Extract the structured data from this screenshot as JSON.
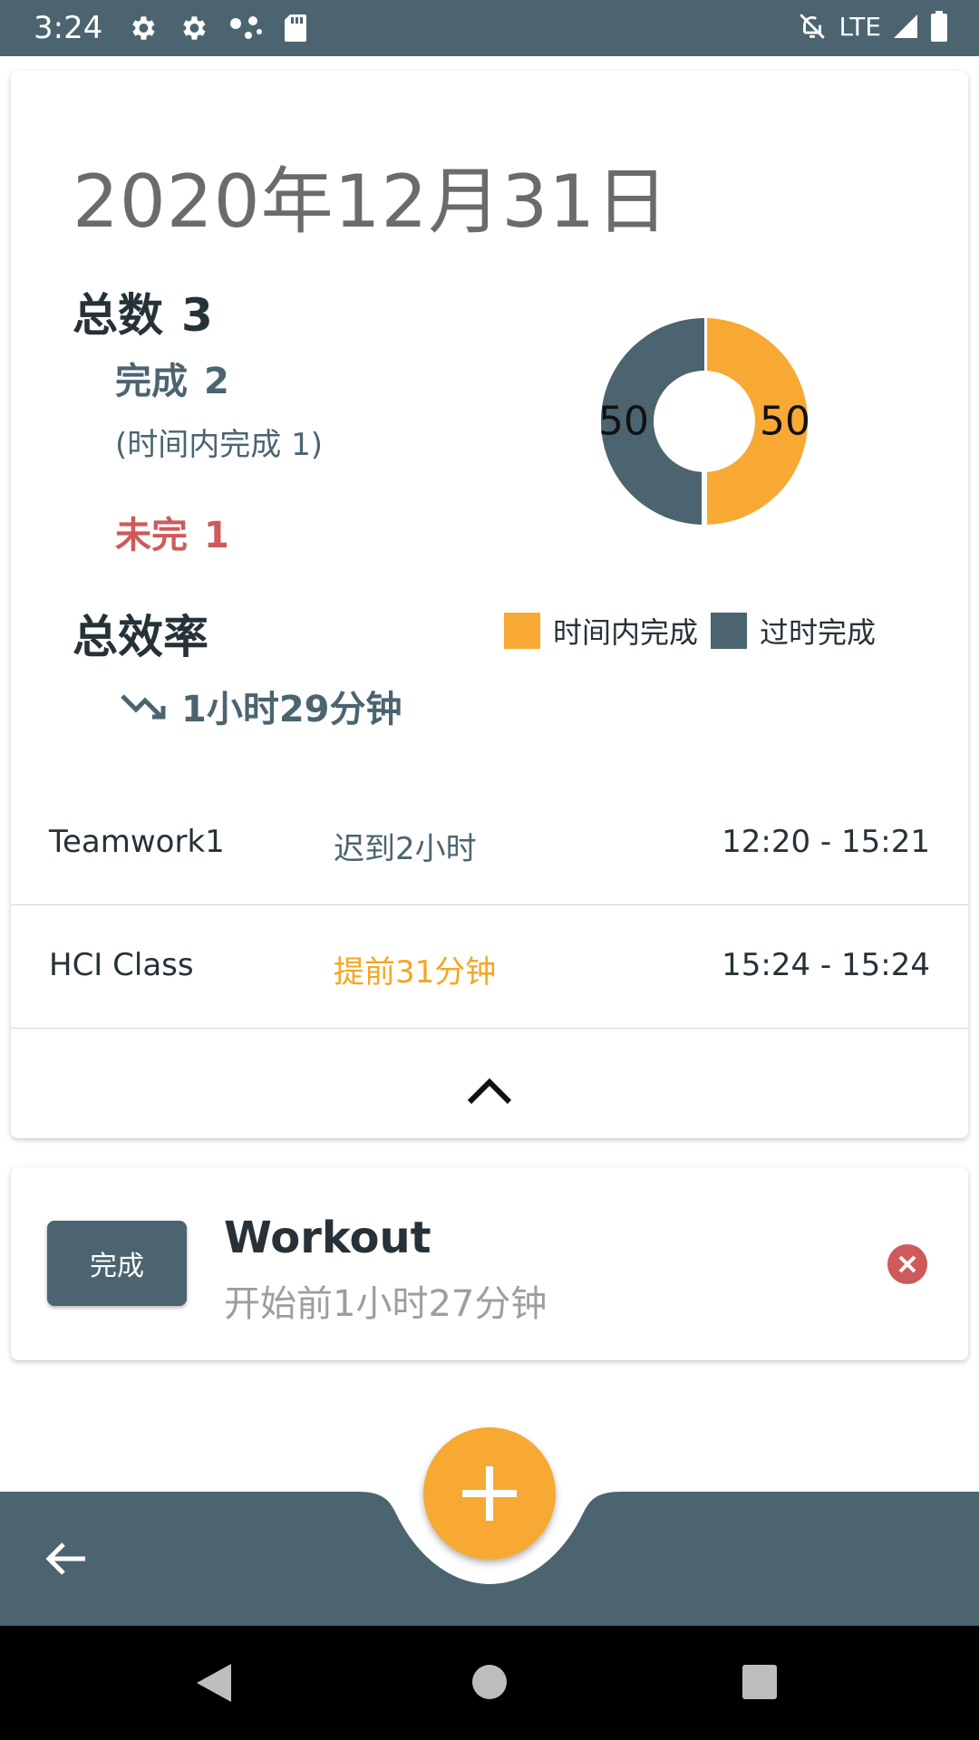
{
  "status_bar": {
    "time": "3:24",
    "network": "LTE",
    "icons": [
      "gear-icon",
      "gear-icon",
      "dots-icon",
      "sd-card-icon",
      "mute-icon",
      "signal-icon",
      "battery-icon"
    ]
  },
  "summary": {
    "date": "2020年12月31日",
    "total_label": "总数",
    "total_value": "3",
    "done_label": "完成",
    "done_value": "2",
    "ontime_text": "(时间内完成  1)",
    "undone_label": "未完",
    "undone_value": "1",
    "efficiency_label": "总效率",
    "efficiency_value": "1小时29分钟",
    "efficiency_icon": "trending-down-icon"
  },
  "chart_data": {
    "type": "pie",
    "categories": [
      "时间内完成",
      "过时完成"
    ],
    "values": [
      50,
      50
    ],
    "colors": [
      "#f7a933",
      "#4b6470"
    ],
    "legend": [
      "时间内完成",
      "过时完成"
    ],
    "legend_position": "right"
  },
  "tasks_done": [
    {
      "name": "Teamwork1",
      "status": "迟到2小时",
      "time": "12:20 - 15:21"
    },
    {
      "name": "HCI Class",
      "status": "提前31分钟",
      "time": "15:24 - 15:24"
    }
  ],
  "task_pending": {
    "button_label": "完成",
    "title": "Workout",
    "subtitle": "开始前1小时27分钟"
  },
  "colors": {
    "primary": "#4b6470",
    "accent": "#f7a933",
    "danger": "#cf5a5a"
  }
}
